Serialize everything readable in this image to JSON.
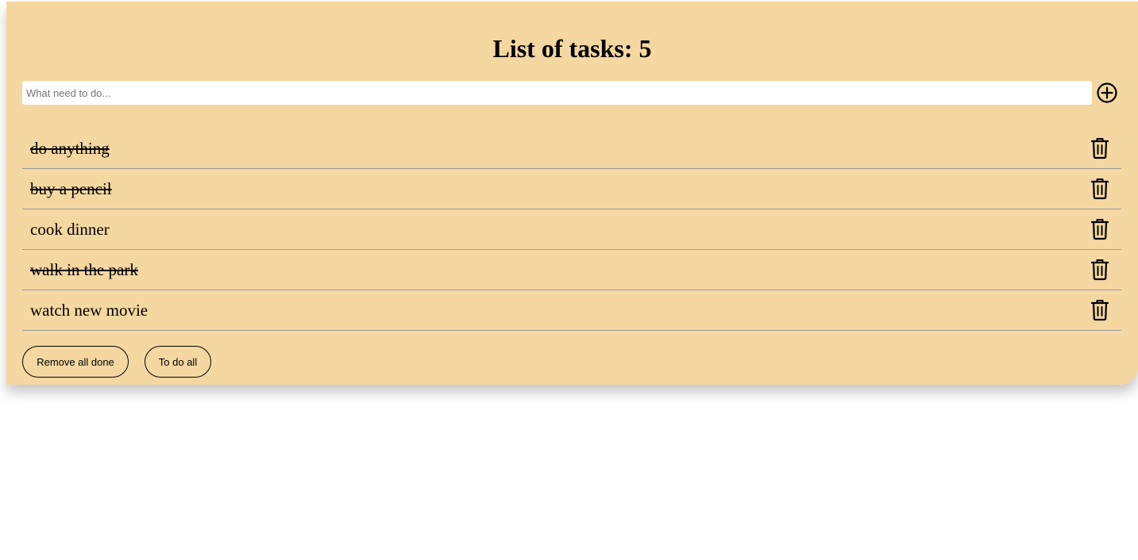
{
  "header": {
    "title": "List of tasks: 5"
  },
  "new_task": {
    "placeholder": "What need to do...",
    "value": "",
    "add_icon": "plus-circle-icon"
  },
  "tasks": [
    {
      "text": "do anything",
      "done": true,
      "delete_icon": "trash-icon"
    },
    {
      "text": "buy a pencil",
      "done": true,
      "delete_icon": "trash-icon"
    },
    {
      "text": "cook dinner",
      "done": false,
      "delete_icon": "trash-icon"
    },
    {
      "text": "walk in the park",
      "done": true,
      "delete_icon": "trash-icon"
    },
    {
      "text": "watch new movie",
      "done": false,
      "delete_icon": "trash-icon"
    }
  ],
  "footer": {
    "remove_all_done_label": "Remove all done",
    "todo_all_label": "To do all"
  },
  "colors": {
    "card_background": "#f5d7a1",
    "divider": "#9a9a9a",
    "text": "#000000"
  }
}
